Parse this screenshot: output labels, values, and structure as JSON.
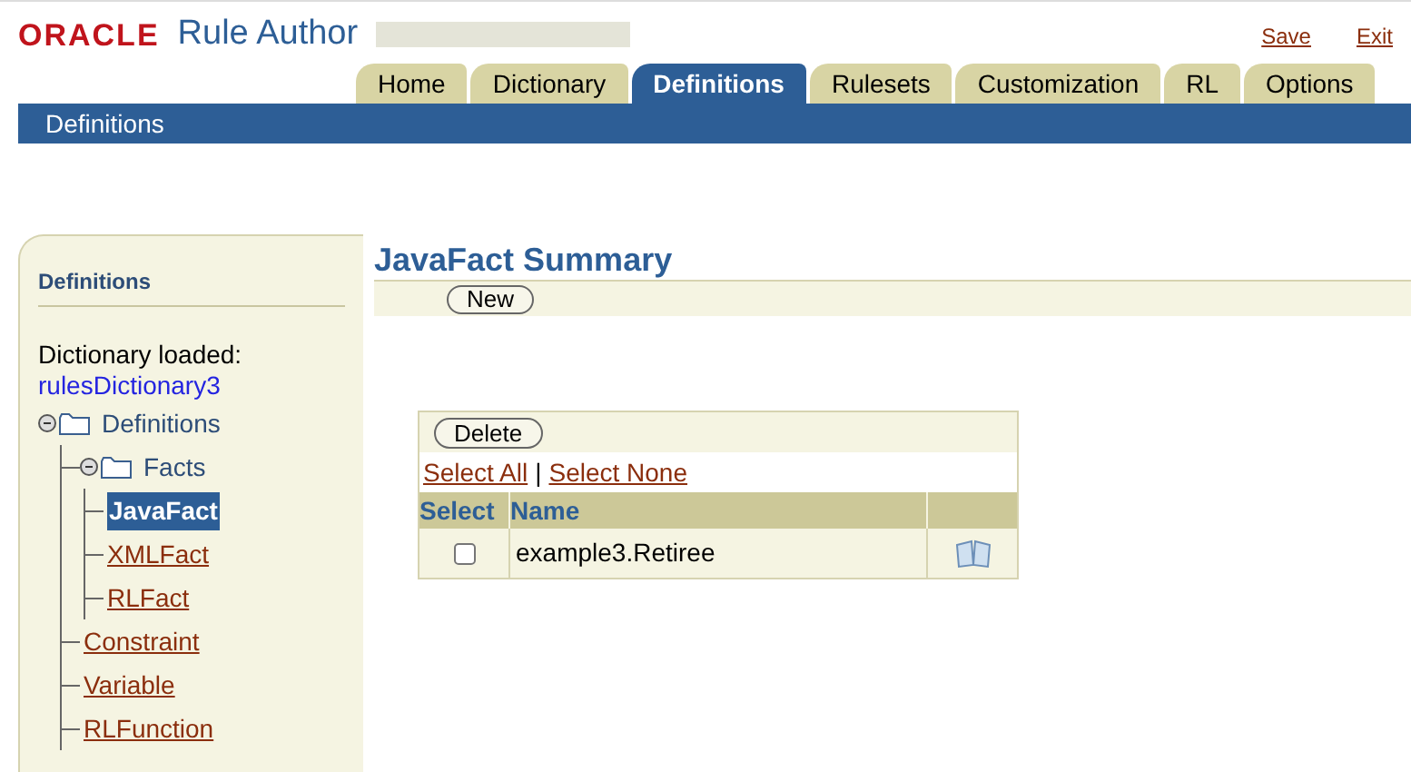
{
  "header": {
    "logo": "ORACLE",
    "app_title": "Rule Author",
    "links": [
      "Save",
      "Exit"
    ]
  },
  "tabs": [
    {
      "label": "Home",
      "selected": false
    },
    {
      "label": "Dictionary",
      "selected": false
    },
    {
      "label": "Definitions",
      "selected": true
    },
    {
      "label": "Rulesets",
      "selected": false
    },
    {
      "label": "Customization",
      "selected": false
    },
    {
      "label": "RL",
      "selected": false
    },
    {
      "label": "Options",
      "selected": false
    }
  ],
  "page_bar": {
    "title": "Definitions"
  },
  "sidebar": {
    "title": "Definitions",
    "dictionary_label": "Dictionary loaded:",
    "dictionary_name": "rulesDictionary3",
    "tree": [
      {
        "label": "Definitions",
        "kind": "folder",
        "expanded": true,
        "children": [
          {
            "label": "Facts",
            "kind": "folder",
            "expanded": true,
            "children": [
              {
                "label": "JavaFact",
                "kind": "link",
                "selected": true
              },
              {
                "label": "XMLFact",
                "kind": "link",
                "selected": false
              },
              {
                "label": "RLFact",
                "kind": "link",
                "selected": false
              }
            ]
          },
          {
            "label": "Constraint",
            "kind": "link",
            "selected": false
          },
          {
            "label": "Variable",
            "kind": "link",
            "selected": false
          },
          {
            "label": "RLFunction",
            "kind": "link",
            "selected": false
          }
        ]
      }
    ]
  },
  "main": {
    "title": "JavaFact Summary",
    "new_button": "New",
    "table": {
      "delete_button": "Delete",
      "select_all": "Select All",
      "separator": "|",
      "select_none": "Select None",
      "columns": [
        "Select",
        "Name"
      ],
      "rows": [
        {
          "checked": false,
          "name": "example3.Retiree"
        }
      ]
    }
  }
}
